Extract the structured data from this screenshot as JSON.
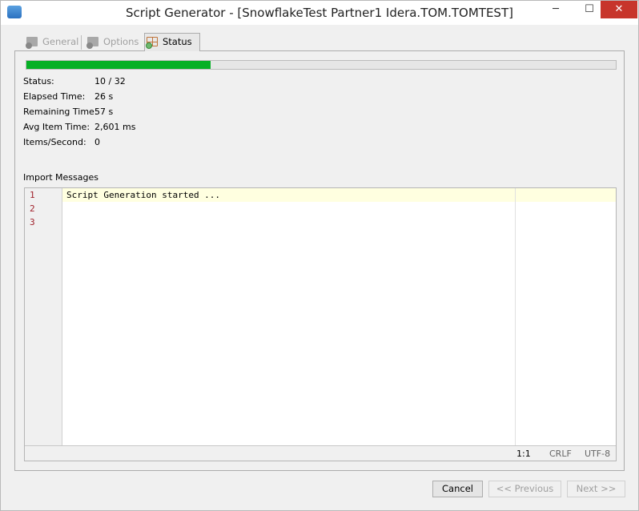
{
  "window": {
    "title": "Script Generator - [SnowflakeTest Partner1 Idera.TOM.TOMTEST]",
    "minimize": "─",
    "maximize": "☐",
    "close": "✕"
  },
  "tabs": [
    {
      "label": "General",
      "enabled": false
    },
    {
      "label": "Options",
      "enabled": false
    },
    {
      "label": "Status",
      "active": true
    }
  ],
  "progress": {
    "percent": 31.25,
    "color": "#06b025"
  },
  "stats": [
    {
      "label": "Status:",
      "value": "10 / 32"
    },
    {
      "label": "Elapsed Time:",
      "value": "26 s"
    },
    {
      "label": "Remaining Time:",
      "value": "57 s"
    },
    {
      "label": "Avg Item Time:",
      "value": "2,601 ms"
    },
    {
      "label": "Items/Second:",
      "value": "0"
    }
  ],
  "messages": {
    "label": "Import Messages",
    "line_numbers": [
      "1",
      "2",
      "3"
    ],
    "lines": [
      "Script Generation started ..."
    ],
    "status": {
      "position": "1:1",
      "line_ending": "CRLF",
      "encoding": "UTF-8"
    }
  },
  "buttons": {
    "cancel": "Cancel",
    "previous": "<< Previous",
    "next": "Next >>"
  }
}
